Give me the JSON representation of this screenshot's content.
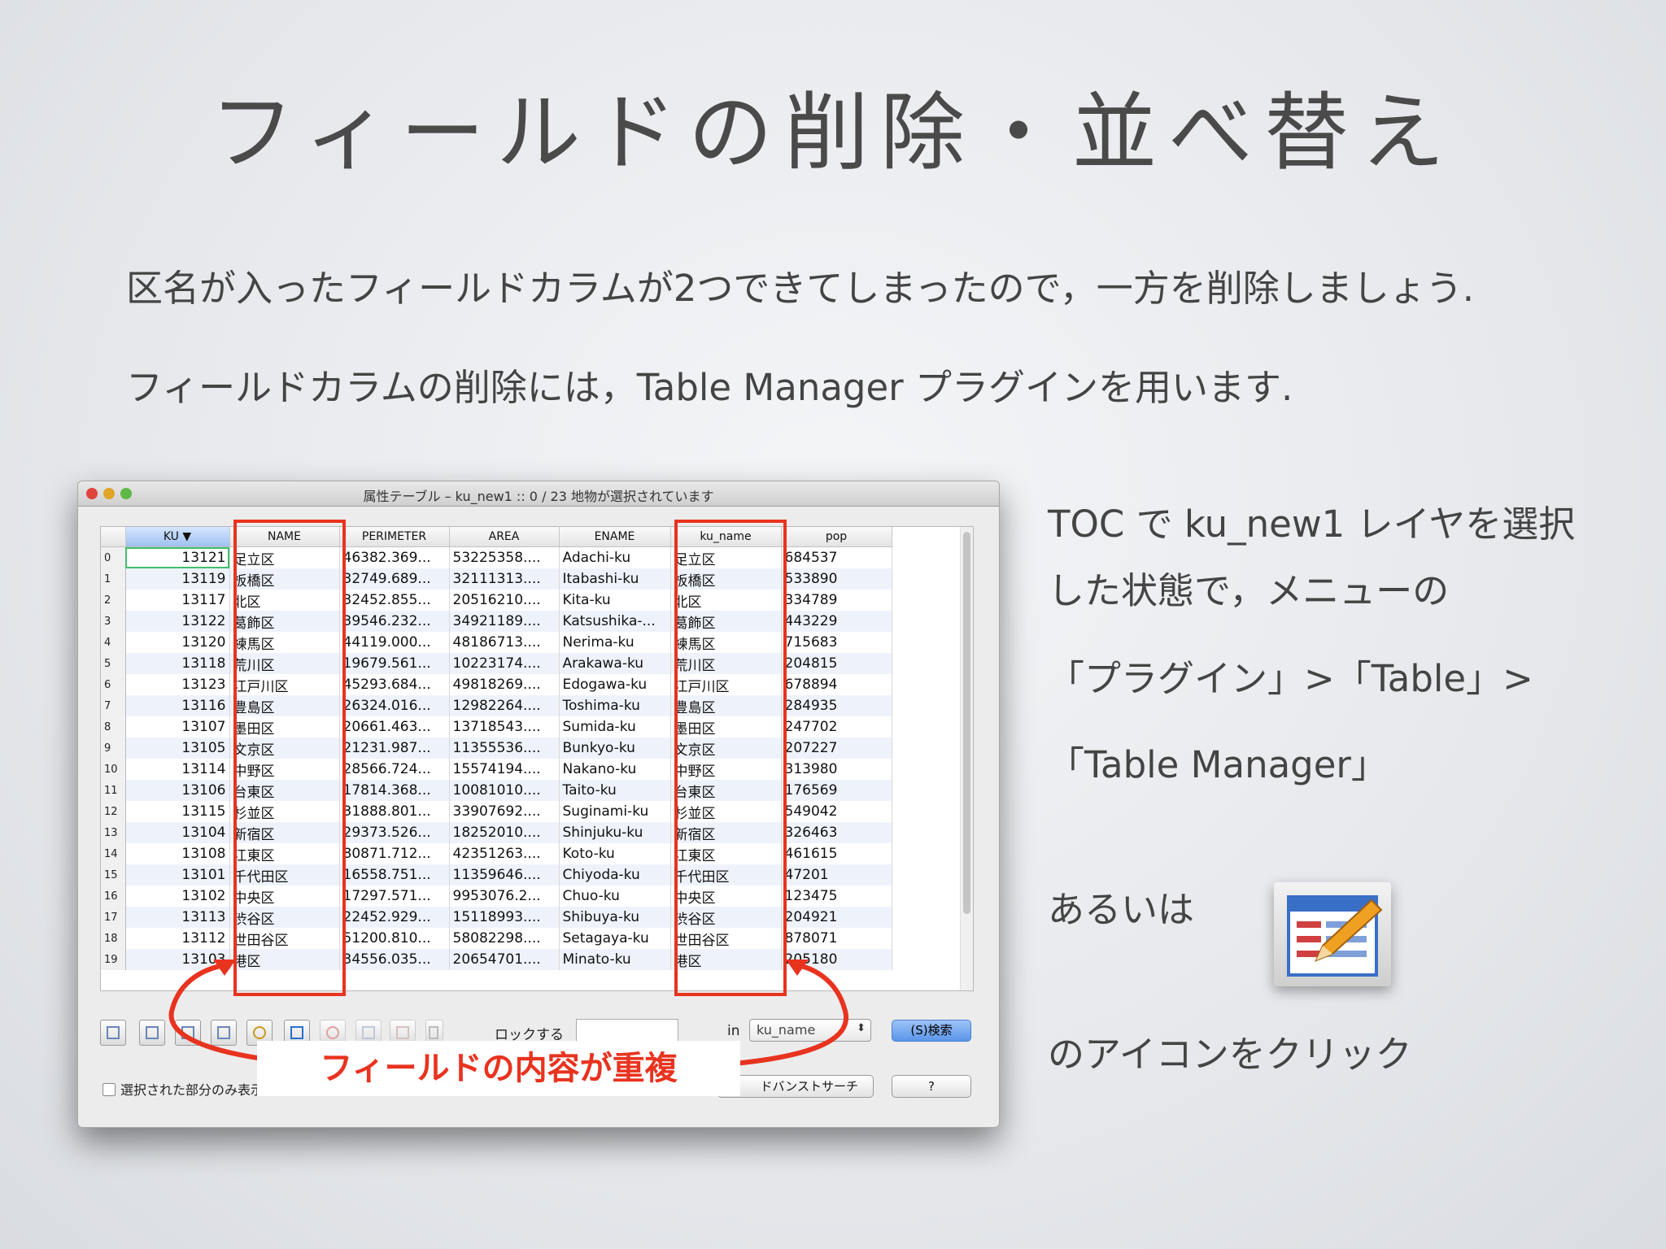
{
  "slide": {
    "title": "フィールドの削除・並べ替え",
    "line1": "区名が入ったフィールドカラムが2つできてしまったので，一方を削除しましょう.",
    "line2": "フィールドカラムの削除には，Table Manager プラグインを用います."
  },
  "window": {
    "title": "属性テーブル – ku_new1 :: 0 / 23 地物が選択されています",
    "columns": [
      "KU",
      "NAME",
      "PERIMETER",
      "AREA",
      "ENAME",
      "ku_name",
      "pop"
    ],
    "rows": [
      [
        "0",
        "13121",
        "足立区",
        "46382.369...",
        "53225358....",
        "Adachi-ku",
        "足立区",
        "684537"
      ],
      [
        "1",
        "13119",
        "板橋区",
        "32749.689...",
        "32111313....",
        "Itabashi-ku",
        "板橋区",
        "533890"
      ],
      [
        "2",
        "13117",
        "北区",
        "32452.855...",
        "20516210....",
        "Kita-ku",
        "北区",
        "334789"
      ],
      [
        "3",
        "13122",
        "葛飾区",
        "39546.232...",
        "34921189....",
        "Katsushika-...",
        "葛飾区",
        "443229"
      ],
      [
        "4",
        "13120",
        "練馬区",
        "44119.000...",
        "48186713....",
        "Nerima-ku",
        "練馬区",
        "715683"
      ],
      [
        "5",
        "13118",
        "荒川区",
        "19679.561...",
        "10223174....",
        "Arakawa-ku",
        "荒川区",
        "204815"
      ],
      [
        "6",
        "13123",
        "江戸川区",
        "45293.684...",
        "49818269....",
        "Edogawa-ku",
        "江戸川区",
        "678894"
      ],
      [
        "7",
        "13116",
        "豊島区",
        "26324.016...",
        "12982264....",
        "Toshima-ku",
        "豊島区",
        "284935"
      ],
      [
        "8",
        "13107",
        "墨田区",
        "20661.463...",
        "13718543....",
        "Sumida-ku",
        "墨田区",
        "247702"
      ],
      [
        "9",
        "13105",
        "文京区",
        "21231.987...",
        "11355536....",
        "Bunkyo-ku",
        "文京区",
        "207227"
      ],
      [
        "10",
        "13114",
        "中野区",
        "28566.724...",
        "15574194....",
        "Nakano-ku",
        "中野区",
        "313980"
      ],
      [
        "11",
        "13106",
        "台東区",
        "17814.368...",
        "10081010....",
        "Taito-ku",
        "台東区",
        "176569"
      ],
      [
        "12",
        "13115",
        "杉並区",
        "31888.801...",
        "33907692....",
        "Suginami-ku",
        "杉並区",
        "549042"
      ],
      [
        "13",
        "13104",
        "新宿区",
        "29373.526...",
        "18252010....",
        "Shinjuku-ku",
        "新宿区",
        "326463"
      ],
      [
        "14",
        "13108",
        "江東区",
        "80871.712...",
        "42351263....",
        "Koto-ku",
        "江東区",
        "461615"
      ],
      [
        "15",
        "13101",
        "千代田区",
        "16558.751...",
        "11359646....",
        "Chiyoda-ku",
        "千代田区",
        "47201"
      ],
      [
        "16",
        "13102",
        "中央区",
        "17297.571...",
        "9953076.2...",
        "Chuo-ku",
        "中央区",
        "123475"
      ],
      [
        "17",
        "13113",
        "渋谷区",
        "22452.929...",
        "15118993....",
        "Shibuya-ku",
        "渋谷区",
        "204921"
      ],
      [
        "18",
        "13112",
        "世田谷区",
        "51200.810...",
        "58082298....",
        "Setagaya-ku",
        "世田谷区",
        "878071"
      ],
      [
        "19",
        "13103",
        "港区",
        "34556.035...",
        "20654701....",
        "Minato-ku",
        "港区",
        "205180"
      ]
    ],
    "lock_label": "ロックする",
    "lock_value": "",
    "in_label": "in",
    "field_select": "ku_name",
    "search_button": "(S)検索",
    "show_selected_label": "選択された部分のみ表示する",
    "advanced_search_button": "ドバンストサーチ",
    "help_button": "?",
    "callout": "フィールドの内容が重複",
    "colors": {
      "highlight": "#e8331f",
      "search_button": "#5b95e8"
    }
  },
  "instructions": {
    "line1": "TOC で ku_new1 レイヤを選択",
    "line2": "した状態で，メニューの",
    "line3": "「プラグイン」>「Table」>",
    "line4": "「Table Manager」",
    "alt": "あるいは",
    "click": "のアイコンをクリック",
    "icon": "table-manager-plugin-icon"
  }
}
